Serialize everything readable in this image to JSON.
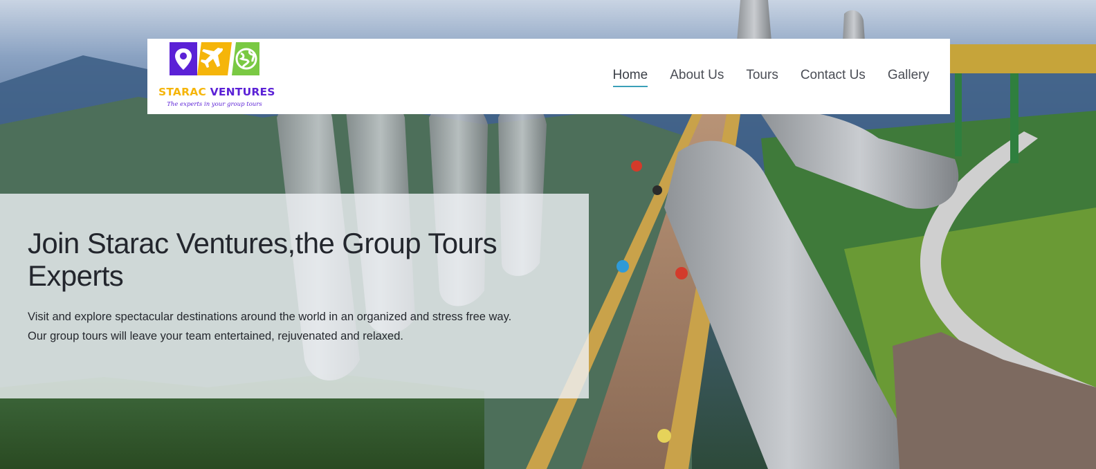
{
  "site": {
    "logo": {
      "name": "STARAC VENTURES",
      "tagline": "The experts in your group tours",
      "icons": [
        "map-pin-icon",
        "airplane-icon",
        "globe-icon"
      ],
      "colors": {
        "purple": "#5b21d6",
        "yellow": "#f5b50a",
        "green": "#7ac943"
      }
    }
  },
  "nav": {
    "items": [
      {
        "label": "Home",
        "active": true
      },
      {
        "label": "About Us",
        "active": false
      },
      {
        "label": "Tours",
        "active": false
      },
      {
        "label": "Contact Us",
        "active": false
      },
      {
        "label": "Gallery",
        "active": false
      }
    ],
    "active_underline_color": "#3aa0b8"
  },
  "hero": {
    "title": "Join Starac Ventures,the Group Tours Experts",
    "description_line1": "Visit and explore spectacular destinations around the world in an organized and stress free way.",
    "description_line2": "Our group tours will leave your team entertained, rejuvenated and relaxed.",
    "background_image": "golden-bridge-hands-photo"
  }
}
